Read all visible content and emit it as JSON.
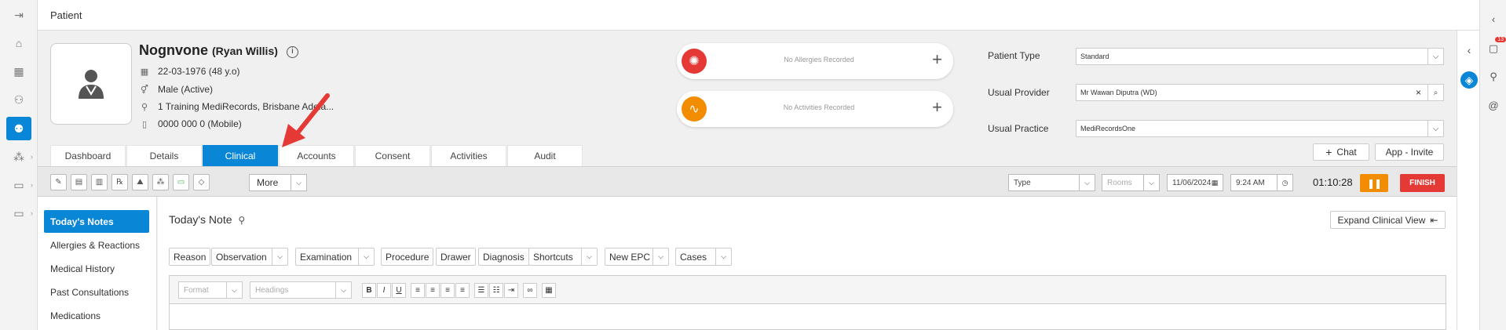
{
  "page": {
    "title": "Patient"
  },
  "patient": {
    "name": "Nognvone",
    "alias": "(Ryan Willis)",
    "dob": "22-03-1976 (48 y.o)",
    "gender": "Male (Active)",
    "address": "1 Training MediRecords, Brisbane Adela...",
    "phone": "0000 000 0 (Mobile)"
  },
  "alerts": {
    "allergies": "No Allergies Recorded",
    "activities": "No Activities Recorded"
  },
  "fields": {
    "patient_type_label": "Patient Type",
    "patient_type_value": "Standard",
    "usual_provider_label": "Usual Provider",
    "usual_provider_value": "Mr Wawan Diputra (WD)",
    "usual_practice_label": "Usual Practice",
    "usual_practice_value": "MediRecordsOne"
  },
  "actions": {
    "chat": "Chat",
    "invite": "App - Invite"
  },
  "tabs": [
    {
      "label": "Dashboard"
    },
    {
      "label": "Details"
    },
    {
      "label": "Clinical"
    },
    {
      "label": "Accounts"
    },
    {
      "label": "Consent"
    },
    {
      "label": "Activities"
    },
    {
      "label": "Audit"
    }
  ],
  "toolbar": {
    "more_label": "More",
    "type_placeholder": "Type",
    "rooms_placeholder": "Rooms",
    "date": "11/06/2024",
    "time": "9:24 AM",
    "timer": "01:10:28",
    "finish_label": "FINISH"
  },
  "leftnav": [
    {
      "label": "Today's Notes"
    },
    {
      "label": "Allergies & Reactions"
    },
    {
      "label": "Medical History"
    },
    {
      "label": "Past Consultations"
    },
    {
      "label": "Medications"
    }
  ],
  "note": {
    "title": "Today's Note",
    "expand_label": "Expand Clinical View",
    "buttons": [
      "Reason",
      "Observation",
      "Examination",
      "Procedure",
      "Drawer",
      "Diagnosis",
      "Shortcuts",
      "New EPC",
      "Cases"
    ],
    "format_placeholder": "Format",
    "headings_placeholder": "Headings"
  },
  "badges": {
    "notifications": "13"
  },
  "colors": {
    "accent": "#0a86d6",
    "allergy": "#e53935",
    "activity": "#f28c00",
    "finish": "#e53935",
    "pause": "#f28c00"
  }
}
